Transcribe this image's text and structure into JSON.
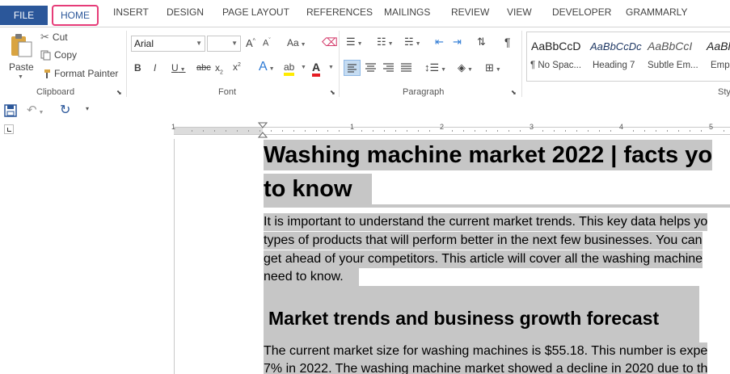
{
  "tabs": {
    "file": "FILE",
    "home": "HOME",
    "items": [
      "INSERT",
      "DESIGN",
      "PAGE LAYOUT",
      "REFERENCES",
      "MAILINGS",
      "REVIEW",
      "VIEW",
      "DEVELOPER",
      "GRAMMARLY"
    ]
  },
  "clipboard": {
    "paste": "Paste",
    "cut": "Cut",
    "copy": "Copy",
    "format_painter": "Format Painter",
    "label": "Clipboard"
  },
  "font": {
    "name": "Arial",
    "size": "",
    "label": "Font"
  },
  "paragraph": {
    "label": "Paragraph"
  },
  "styles": {
    "items": [
      {
        "preview": "AaBbCcD",
        "name": "¶ No Spac..."
      },
      {
        "preview": "AaBbCcDc",
        "name": "Heading 7"
      },
      {
        "preview": "AaBbCcI",
        "name": "Subtle Em..."
      },
      {
        "preview": "AaBl",
        "name": "Emp"
      }
    ],
    "label": "Sty"
  },
  "ruler": {
    "numbers": [
      "1",
      "1",
      "2",
      "3",
      "4",
      "5"
    ]
  },
  "document": {
    "title_line1": "Washing machine market 2022 | facts yo",
    "title_line2": "to know",
    "para1": [
      "It is important to understand the current market trends. This key data helps yo",
      "types of products that will perform better in the next few businesses. You can",
      "get ahead of your competitors. This article will cover all the washing machine",
      "need to know."
    ],
    "heading2": "Market trends and business growth forecast",
    "para2": [
      "The current market size for washing machines is $55.18. This number is expe",
      "7% in 2022. The washing machine market showed a decline in 2020 due to th"
    ]
  }
}
